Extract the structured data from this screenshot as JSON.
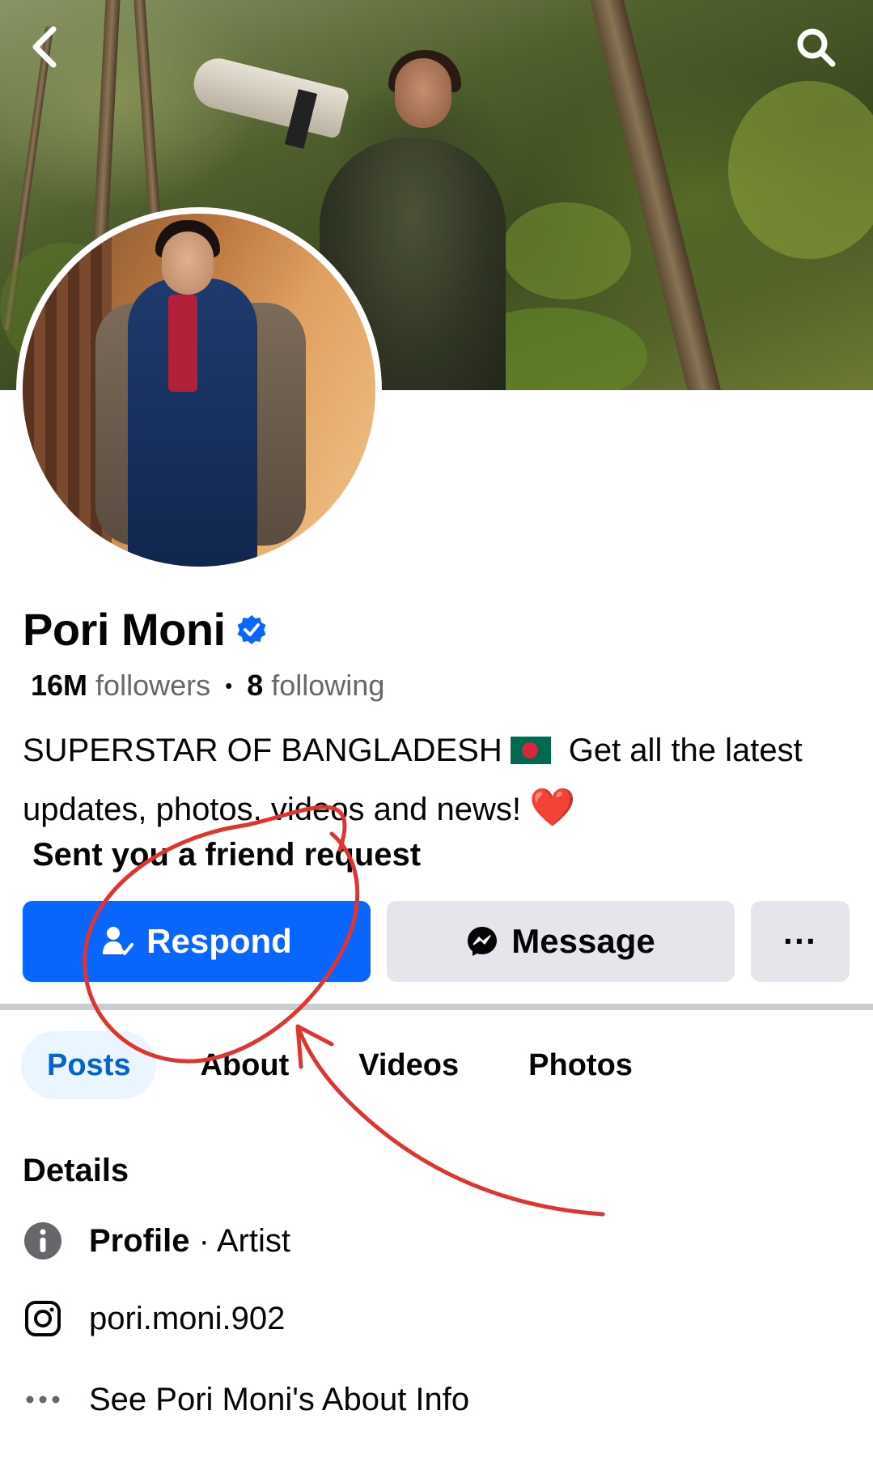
{
  "header": {
    "back_icon": "chevron-left-icon",
    "search_icon": "search-icon"
  },
  "profile": {
    "name": "Pori Moni",
    "verified_icon": "verified-badge-icon",
    "followers_count": "16M",
    "followers_label": "followers",
    "following_count": "8",
    "following_label": "following",
    "bio_line1": "SUPERSTAR OF BANGLADESH",
    "bio_after_flag": "Get all the latest",
    "bio_line2": "updates, photos, videos and news!",
    "bio_heart": "❤️",
    "friend_request_text": "Sent you a friend request"
  },
  "actions": {
    "respond_label": "Respond",
    "message_label": "Message",
    "more_label": "···"
  },
  "tabs": [
    {
      "label": "Posts",
      "active": true
    },
    {
      "label": "About",
      "active": false
    },
    {
      "label": "Videos",
      "active": false
    },
    {
      "label": "Photos",
      "active": false
    }
  ],
  "details": {
    "title": "Details",
    "profile_label": "Profile",
    "profile_separator": " · ",
    "profile_category": "Artist",
    "instagram_handle": "pori.moni.902",
    "see_about": "See Pori Moni's About Info"
  },
  "colors": {
    "accent_blue": "#0866ff",
    "annotation_red": "#e0342f",
    "tab_active_bg": "#ebf5ff",
    "tab_active_text": "#0064d1"
  }
}
